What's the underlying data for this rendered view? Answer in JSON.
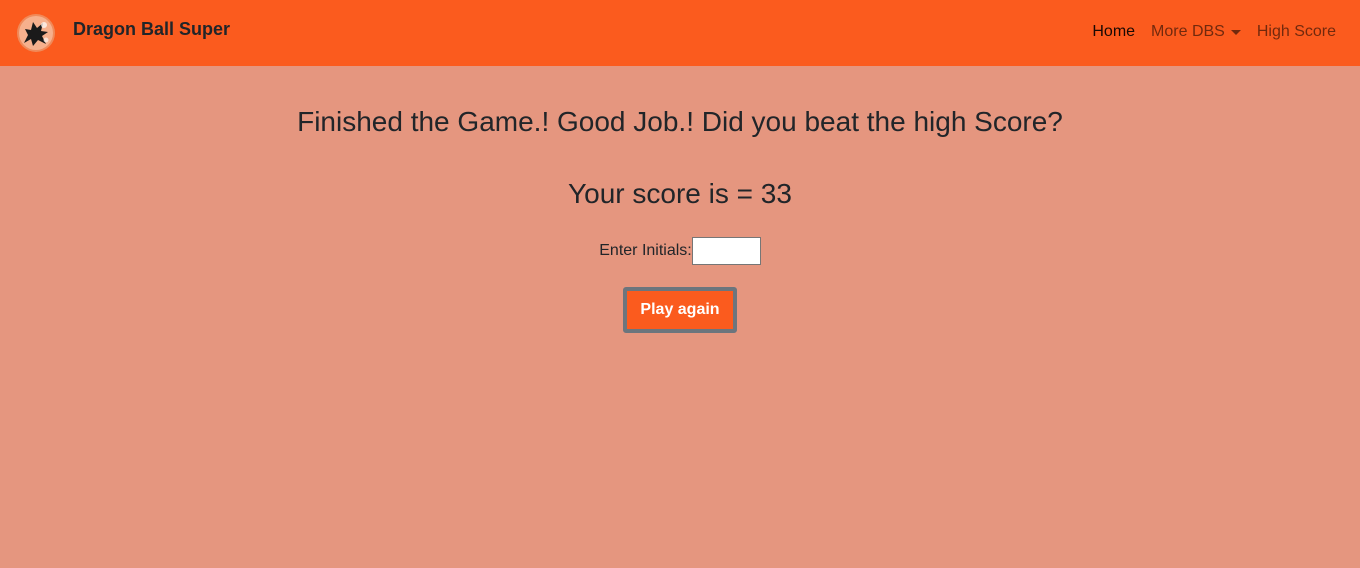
{
  "navbar": {
    "brand": "Dragon Ball Super",
    "logo_icon": "dragon-emblem-icon",
    "links": {
      "home": "Home",
      "more": "More DBS",
      "high_score": "High Score"
    }
  },
  "main": {
    "heading": "Finished the Game.! Good Job.! Did you beat the high Score?",
    "score_text": "Your score is = 33",
    "initials_label": "Enter Initials:",
    "initials_value": "",
    "play_again_label": "Play again"
  },
  "colors": {
    "navbar_bg": "#fb5b1e",
    "page_bg": "#e5967f",
    "button_bg": "#fb5b1e",
    "button_border": "#6c757d"
  }
}
